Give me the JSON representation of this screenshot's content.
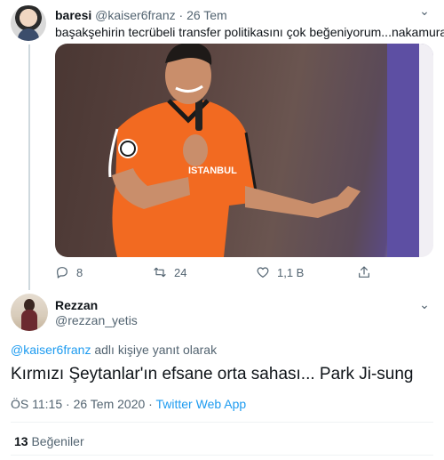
{
  "tweet": {
    "author_name": "baresi",
    "author_handle": "@kaiser6franz",
    "separator": "·",
    "date": "26 Tem",
    "text": "başakşehirin tecrübeli transfer politikasını çok beğeniyorum...nakamura",
    "more_icon": "more-horizontal-icon",
    "media": {
      "description_icon": "photo",
      "jersey_text": "ISTANBUL"
    },
    "actions": {
      "reply_count": "8",
      "retweet_count": "24",
      "like_count": "1,1 B"
    }
  },
  "reply": {
    "author_name": "Rezzan",
    "author_handle": "@rezzan_yetis",
    "replying_to_handle": "@kaiser6franz",
    "replying_to_suffix": " adlı kişiye yanıt olarak",
    "text": "Kırmızı Şeytanlar'ın efsane orta sahası... Park Ji-sung",
    "time": "ÖS 11:15",
    "separator": " · ",
    "date": "26 Tem 2020",
    "separator2": " · ",
    "app": "Twitter Web App",
    "likes_count": "13",
    "likes_label": " Beğeniler"
  },
  "colors": {
    "link": "#1d9bf0",
    "secondary_text": "#536471",
    "primary_text": "#0f1419",
    "jersey": "#f26a21"
  }
}
